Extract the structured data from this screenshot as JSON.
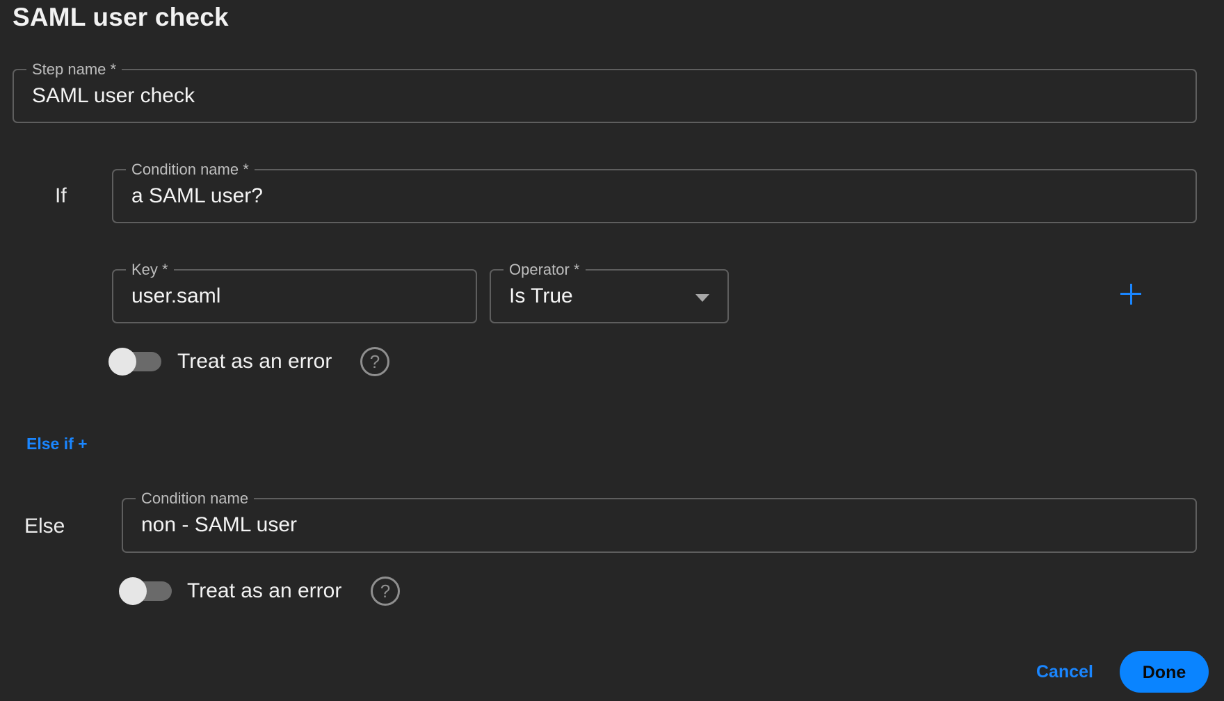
{
  "title": "SAML user check",
  "step_name": {
    "label": "Step name *",
    "value": "SAML user check"
  },
  "if_block": {
    "row_label": "If",
    "condition": {
      "label": "Condition name *",
      "value": "a SAML user?"
    },
    "key": {
      "label": "Key *",
      "value": "user.saml"
    },
    "operator": {
      "label": "Operator *",
      "value": "Is True"
    },
    "add_icon": "plus-icon",
    "treat_as_error": {
      "label": "Treat as an error",
      "enabled": false,
      "help_icon": "help-circle-icon",
      "help_glyph": "?"
    }
  },
  "else_if_link": "Else if +",
  "else_block": {
    "row_label": "Else",
    "condition": {
      "label": "Condition name",
      "value": "non - SAML user"
    },
    "treat_as_error": {
      "label": "Treat as an error",
      "enabled": false,
      "help_icon": "help-circle-icon",
      "help_glyph": "?"
    }
  },
  "footer": {
    "cancel_label": "Cancel",
    "done_label": "Done"
  },
  "colors": {
    "background": "#262626",
    "accent": "#0a84ff",
    "border": "#5e5e5e"
  }
}
